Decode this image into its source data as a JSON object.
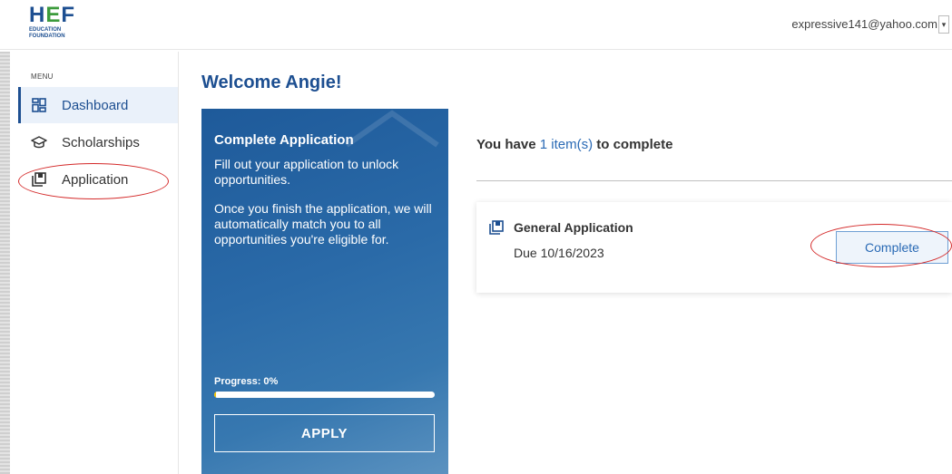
{
  "header": {
    "logo_text": "HEF",
    "logo_subtitle_1": "EDUCATION",
    "logo_subtitle_2": "FOUNDATION",
    "user_email": "expressive141@yahoo.com",
    "user_menu_caret": "▾"
  },
  "sidebar": {
    "menu_label": "MENU",
    "items": [
      {
        "label": "Dashboard",
        "icon": "dashboard-icon",
        "active": true
      },
      {
        "label": "Scholarships",
        "icon": "graduation-cap-icon",
        "active": false
      },
      {
        "label": "Application",
        "icon": "application-icon",
        "active": false
      }
    ]
  },
  "main": {
    "welcome": "Welcome Angie!",
    "application_card": {
      "title": "Complete Application",
      "text_1": "Fill out your application to unlock opportunities.",
      "text_2": "Once you finish the application, we will automatically match you to all opportunities you're eligible for.",
      "progress_label": "Progress: 0%",
      "progress_value": 0.01,
      "apply_label": "APPLY"
    },
    "todo": {
      "prefix": "You have ",
      "count": "1 item(s)",
      "suffix": " to complete"
    },
    "task": {
      "title": "General Application",
      "due": "Due 10/16/2023",
      "button_label": "Complete"
    }
  },
  "colors": {
    "brand_blue": "#1d4f91",
    "link_blue": "#2a6ab5",
    "annotation_red": "#d42a2a",
    "progress_yellow": "#f2c200"
  }
}
